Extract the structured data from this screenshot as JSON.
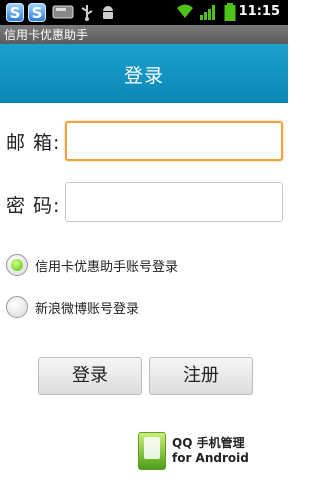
{
  "status_bar": {
    "time": "11:15",
    "left_icons": [
      "s-app-icon",
      "s-app-icon",
      "sd-card-icon",
      "usb-icon",
      "android-debug-icon"
    ],
    "right_icons": [
      "wifi-icon",
      "signal-icon",
      "battery-icon"
    ]
  },
  "app": {
    "name": "信用卡优惠助手"
  },
  "header": {
    "title": "登录"
  },
  "form": {
    "email_label": "邮 箱:",
    "email_value": "",
    "password_label": "密 码:",
    "password_value": ""
  },
  "login_options": [
    {
      "label": "信用卡优惠助手账号登录",
      "selected": true
    },
    {
      "label": "新浪微博账号登录",
      "selected": false
    }
  ],
  "buttons": {
    "login": "登录",
    "register": "注册"
  },
  "watermark": {
    "line1": "QQ 手机管理",
    "line2": "for Android"
  }
}
